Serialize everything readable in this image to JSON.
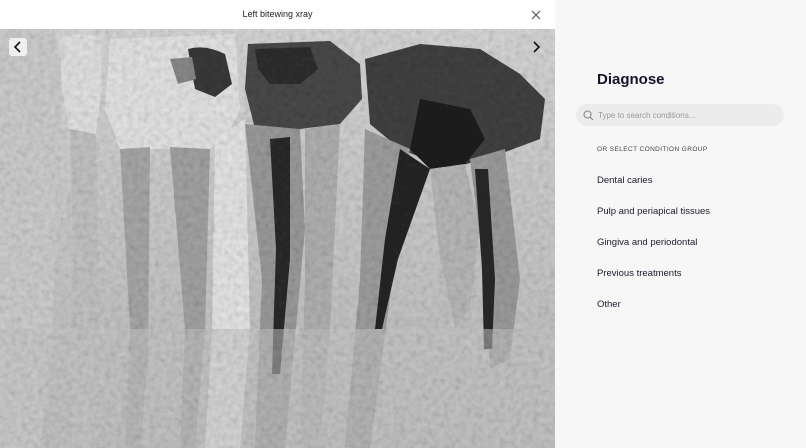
{
  "viewer": {
    "title": "Left bitewing xray"
  },
  "icons": {
    "close": "close-icon",
    "prev": "chevron-left-icon",
    "next": "chevron-right-icon",
    "search": "search-icon"
  },
  "panel": {
    "title": "Diagnose",
    "search": {
      "value": "",
      "placeholder": "Type to search conditions..."
    },
    "group_heading": "OR SELECT CONDITION GROUP",
    "groups": [
      {
        "label": "Dental caries"
      },
      {
        "label": "Pulp and periapical tissues"
      },
      {
        "label": "Gingiva and periodontal"
      },
      {
        "label": "Previous treatments"
      },
      {
        "label": "Other"
      }
    ]
  }
}
